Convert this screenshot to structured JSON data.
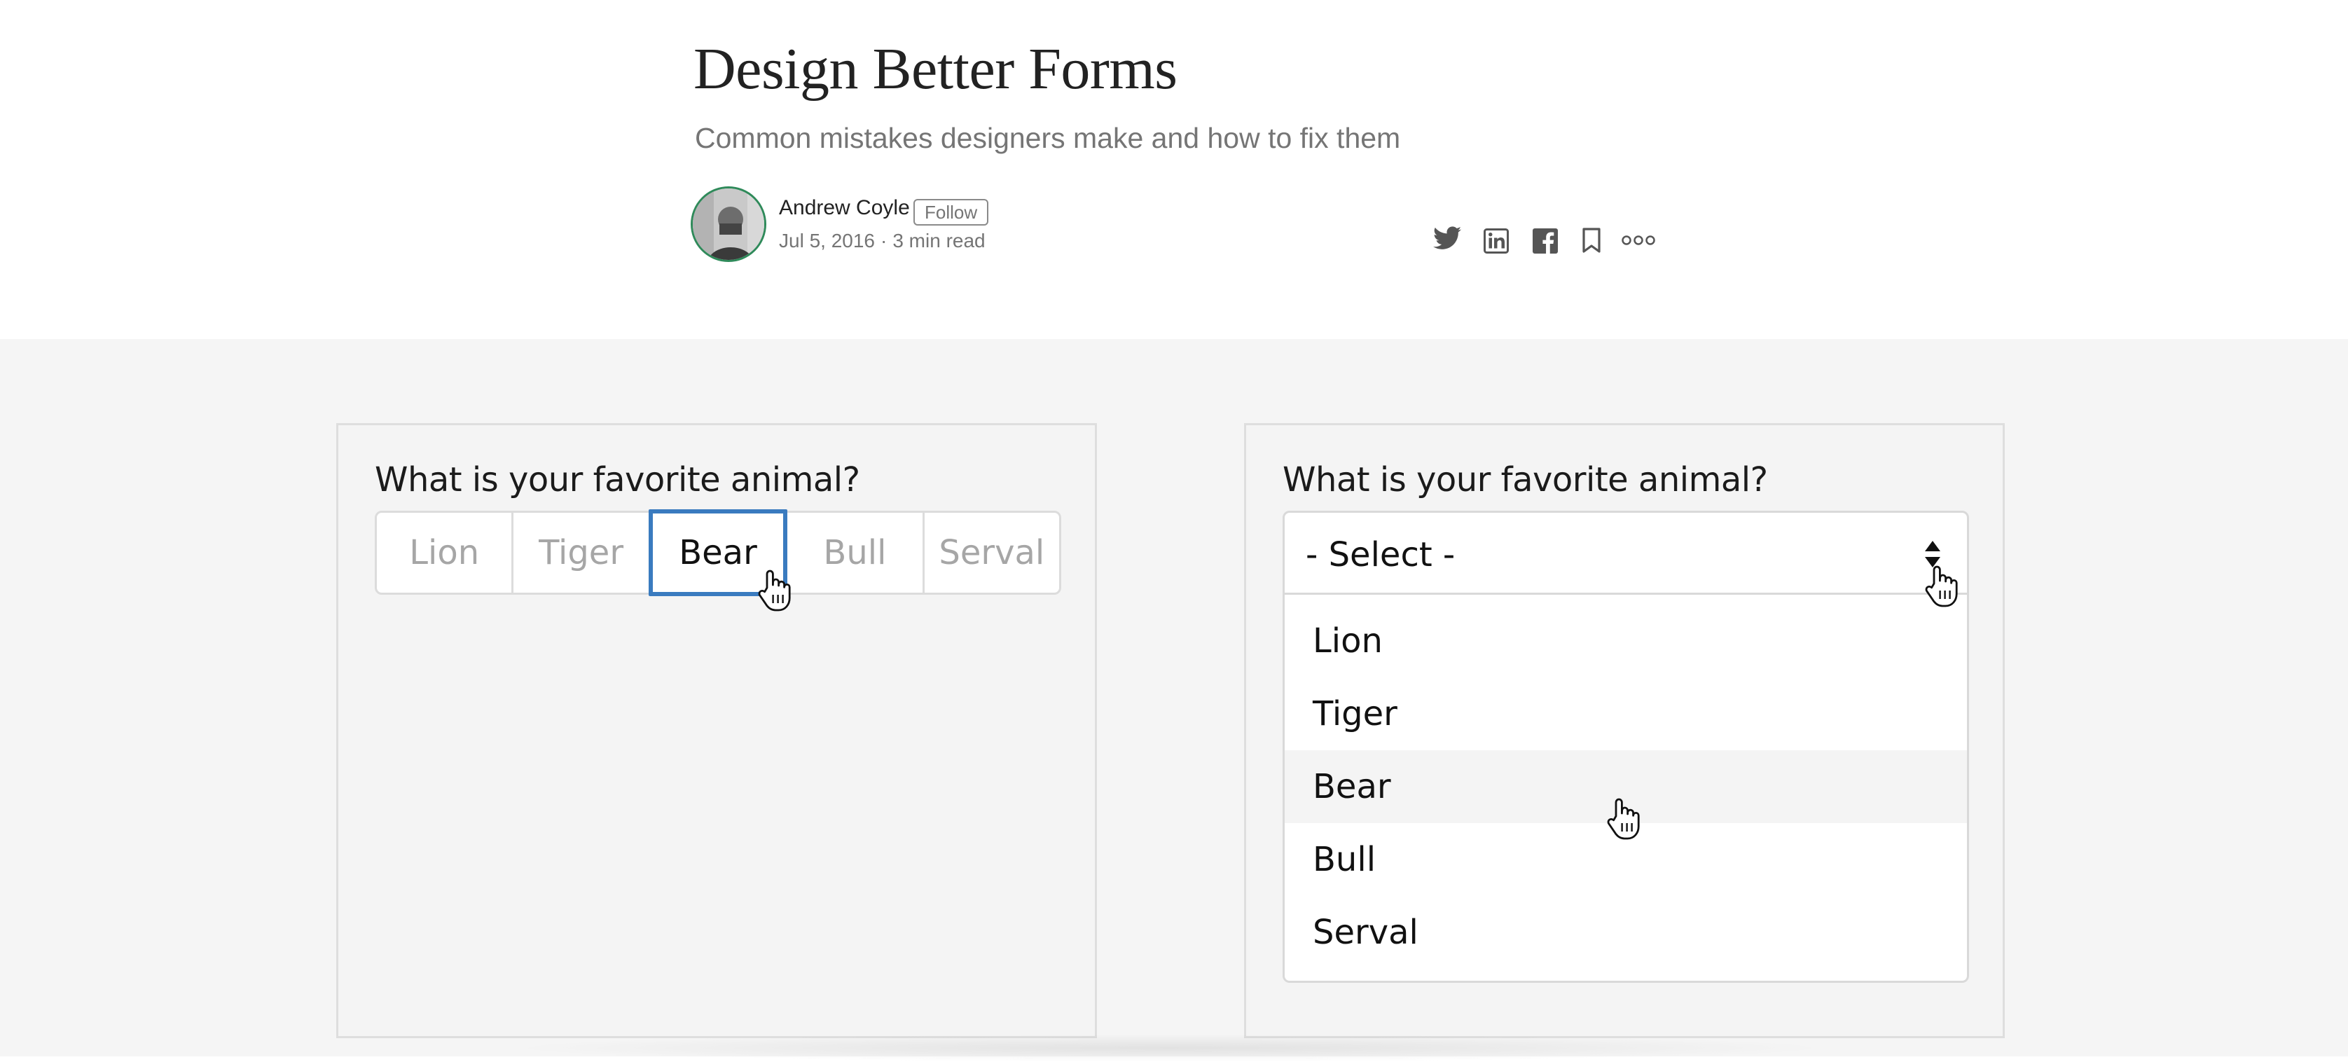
{
  "article": {
    "title": "Design Better Forms",
    "subtitle": "Common mistakes designers make and how to fix them",
    "author": "Andrew Coyle",
    "follow_label": "Follow",
    "date": "Jul 5, 2016",
    "separator": "·",
    "read_time": "3 min read"
  },
  "share_icons": [
    "twitter-icon",
    "linkedin-icon",
    "facebook-icon",
    "bookmark-icon",
    "more-icon"
  ],
  "left_panel": {
    "question": "What is your favorite animal?",
    "options": [
      "Lion",
      "Tiger",
      "Bear",
      "Bull",
      "Serval"
    ],
    "selected": "Bear"
  },
  "right_panel": {
    "question": "What is your favorite animal?",
    "select_value": "- Select -",
    "options": [
      "Lion",
      "Tiger",
      "Bear",
      "Bull",
      "Serval"
    ],
    "hovered": "Bear"
  },
  "colors": {
    "selected_border": "#3a7bbf",
    "avatar_ring": "#2f8a5a",
    "muted_text": "#757575",
    "stage_bg": "#f5f5f5"
  }
}
